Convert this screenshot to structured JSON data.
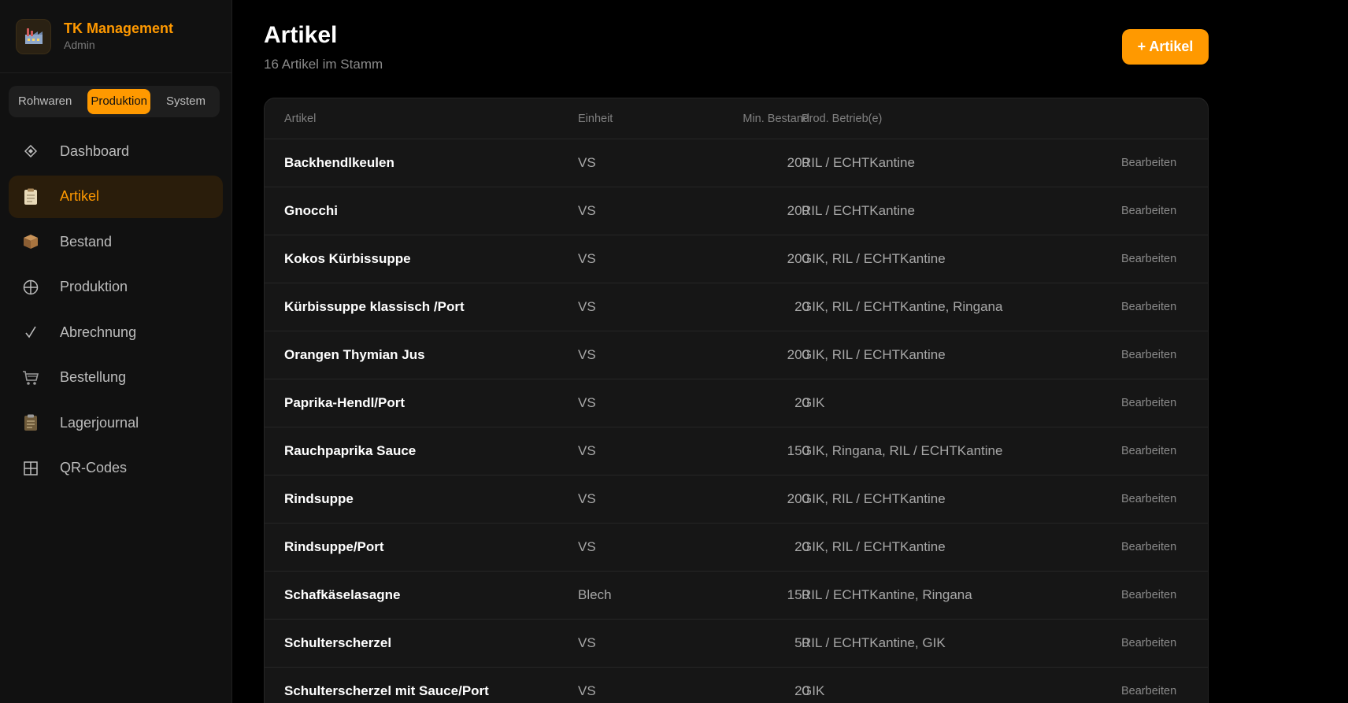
{
  "brand": {
    "title": "TK Management",
    "subtitle": "Admin",
    "logo_icon": "factory-icon"
  },
  "switcher": {
    "items": [
      "Rohwaren",
      "Produktion",
      "System"
    ],
    "active": "Produktion"
  },
  "nav": {
    "items": [
      {
        "label": "Dashboard",
        "icon": "diamond-icon"
      },
      {
        "label": "Artikel",
        "icon": "clipboard-icon",
        "active": true
      },
      {
        "label": "Bestand",
        "icon": "box-icon"
      },
      {
        "label": "Produktion",
        "icon": "globe-icon"
      },
      {
        "label": "Abrechnung",
        "icon": "checkmark-icon"
      },
      {
        "label": "Bestellung",
        "icon": "cart-icon"
      },
      {
        "label": "Lagerjournal",
        "icon": "journal-icon"
      },
      {
        "label": "QR-Codes",
        "icon": "grid-icon"
      }
    ]
  },
  "page": {
    "title": "Artikel",
    "subtitle": "16 Artikel im Stamm",
    "add_button": "+ Artikel"
  },
  "table": {
    "headers": {
      "name": "Artikel",
      "unit": "Einheit",
      "min": "Min. Bestand",
      "prod": "Prod. Betrieb(e)"
    },
    "edit_label": "Bearbeiten",
    "rows": [
      {
        "name": "Backhendlkeulen",
        "unit": "VS",
        "min": "200",
        "prod": "RIL / ECHTKantine"
      },
      {
        "name": "Gnocchi",
        "unit": "VS",
        "min": "200",
        "prod": "RIL / ECHTKantine"
      },
      {
        "name": "Kokos Kürbissuppe",
        "unit": "VS",
        "min": "200",
        "prod": "GIK, RIL / ECHTKantine"
      },
      {
        "name": "Kürbissuppe klassisch /Port",
        "unit": "VS",
        "min": "20",
        "prod": "GIK, RIL / ECHTKantine, Ringana"
      },
      {
        "name": "Orangen Thymian Jus",
        "unit": "VS",
        "min": "200",
        "prod": "GIK, RIL / ECHTKantine"
      },
      {
        "name": "Paprika-Hendl/Port",
        "unit": "VS",
        "min": "20",
        "prod": "GIK"
      },
      {
        "name": "Rauchpaprika Sauce",
        "unit": "VS",
        "min": "150",
        "prod": "GIK, Ringana, RIL / ECHTKantine"
      },
      {
        "name": "Rindsuppe",
        "unit": "VS",
        "min": "200",
        "prod": "GIK, RIL / ECHTKantine"
      },
      {
        "name": "Rindsuppe/Port",
        "unit": "VS",
        "min": "20",
        "prod": "GIK, RIL / ECHTKantine"
      },
      {
        "name": "Schafkäselasagne",
        "unit": "Blech",
        "min": "150",
        "prod": "RIL / ECHTKantine, Ringana"
      },
      {
        "name": "Schulterscherzel",
        "unit": "VS",
        "min": "50",
        "prod": "RIL / ECHTKantine, GIK"
      },
      {
        "name": "Schulterscherzel mit Sauce/Port",
        "unit": "VS",
        "min": "20",
        "prod": "GIK"
      }
    ]
  },
  "colors": {
    "accent": "#ff9900",
    "background": "#000000",
    "sidebar": "#111111",
    "card": "#161616"
  }
}
